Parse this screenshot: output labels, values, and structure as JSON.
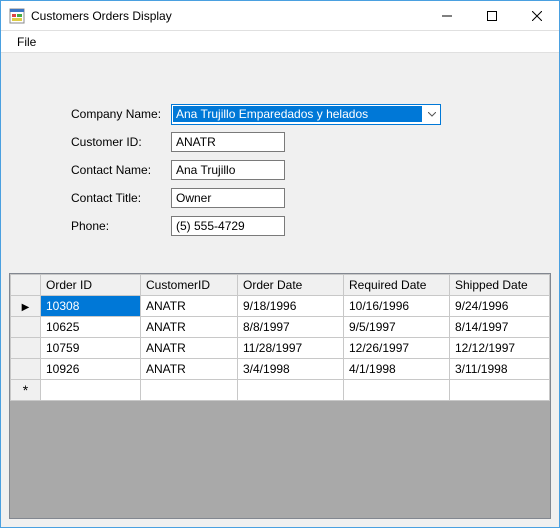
{
  "window": {
    "title": "Customers Orders Display"
  },
  "menu": {
    "file": "File"
  },
  "form": {
    "company_label": "Company Name:",
    "company_value": "Ana Trujillo Emparedados y helados",
    "customer_id_label": "Customer ID:",
    "customer_id_value": "ANATR",
    "contact_name_label": "Contact Name:",
    "contact_name_value": "Ana Trujillo",
    "contact_title_label": "Contact Title:",
    "contact_title_value": "Owner",
    "phone_label": "Phone:",
    "phone_value": "(5) 555-4729"
  },
  "grid": {
    "headers": {
      "order_id": "Order ID",
      "customer_id": "CustomerID",
      "order_date": "Order Date",
      "required_date": "Required Date",
      "shipped_date": "Shipped Date"
    },
    "rows": [
      {
        "order_id": "10308",
        "customer_id": "ANATR",
        "order_date": "9/18/1996",
        "required_date": "10/16/1996",
        "shipped_date": "9/24/1996"
      },
      {
        "order_id": "10625",
        "customer_id": "ANATR",
        "order_date": "8/8/1997",
        "required_date": "9/5/1997",
        "shipped_date": "8/14/1997"
      },
      {
        "order_id": "10759",
        "customer_id": "ANATR",
        "order_date": "11/28/1997",
        "required_date": "12/26/1997",
        "shipped_date": "12/12/1997"
      },
      {
        "order_id": "10926",
        "customer_id": "ANATR",
        "order_date": "3/4/1998",
        "required_date": "4/1/1998",
        "shipped_date": "3/11/1998"
      }
    ],
    "current_row_glyph": "▶",
    "new_row_glyph": "*"
  }
}
